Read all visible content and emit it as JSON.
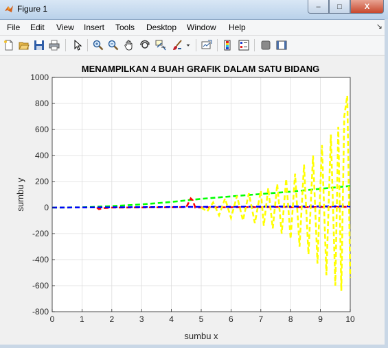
{
  "window": {
    "title": "Figure 1",
    "buttons": {
      "minimize": "–",
      "maximize": "□",
      "close": "X"
    }
  },
  "menu": {
    "items": [
      "File",
      "Edit",
      "View",
      "Insert",
      "Tools",
      "Desktop",
      "Window",
      "Help"
    ],
    "dock_arrow": "↘"
  },
  "toolbar": {
    "icons": [
      "new-figure-icon",
      "open-file-icon",
      "save-icon",
      "print-icon",
      "pointer-icon",
      "zoom-in-icon",
      "zoom-out-icon",
      "pan-icon",
      "rotate-3d-icon",
      "data-cursor-icon",
      "brush-icon",
      "brush-dropdown-icon",
      "link-plot-icon",
      "colorbar-icon",
      "legend-icon",
      "hide-plot-tools-icon",
      "show-plot-tools-icon"
    ]
  },
  "chart_data": {
    "type": "line",
    "title": "MENAMPILKAN 4 BUAH GRAFIK DALAM SATU BIDANG",
    "xlabel": "sumbu x",
    "ylabel": "sumbu y",
    "xlim": [
      0,
      10
    ],
    "ylim": [
      -800,
      1000
    ],
    "xticks": [
      "0",
      "1",
      "2",
      "3",
      "4",
      "5",
      "6",
      "7",
      "8",
      "9",
      "10"
    ],
    "yticks": [
      "-800",
      "-600",
      "-400",
      "-200",
      "0",
      "200",
      "400",
      "600",
      "800",
      "1000"
    ],
    "grid": true,
    "series": [
      {
        "color": "#00ff00",
        "style": "dashed",
        "x": [
          0,
          1,
          2,
          3,
          4,
          5,
          6,
          7,
          8,
          9,
          10
        ],
        "y": [
          0,
          2,
          11,
          24,
          43,
          67,
          86,
          104,
          122,
          144,
          166
        ]
      },
      {
        "color": "#ff0000",
        "style": "dashed",
        "x": [
          1.5,
          1.57,
          1.7,
          2,
          3,
          4,
          4.5,
          4.65,
          4.72,
          4.8,
          5,
          6,
          7,
          7.9,
          8,
          9,
          10
        ],
        "y": [
          0,
          -12,
          -4,
          0,
          1,
          2,
          3,
          70,
          55,
          0,
          1,
          2,
          3,
          5,
          2,
          4,
          5
        ]
      },
      {
        "color": "#0000ff",
        "style": "dashed",
        "x": [
          0,
          1,
          2,
          3,
          4,
          5,
          6,
          7,
          8,
          9,
          10
        ],
        "y": [
          0,
          1,
          2,
          3,
          4,
          5,
          6,
          7,
          8,
          9,
          10
        ]
      },
      {
        "color": "#ffff00",
        "style": "dashed",
        "x": [
          5,
          5.2,
          5.4,
          5.6,
          5.8,
          6,
          6.2,
          6.4,
          6.6,
          6.8,
          7,
          7.1,
          7.25,
          7.4,
          7.55,
          7.7,
          7.85,
          8,
          8.15,
          8.3,
          8.45,
          8.6,
          8.75,
          8.9,
          9.05,
          9.2,
          9.35,
          9.5,
          9.6,
          9.7,
          9.8,
          9.9,
          10
        ],
        "y": [
          0,
          -30,
          40,
          -60,
          70,
          -80,
          90,
          -100,
          110,
          -120,
          130,
          -140,
          150,
          -160,
          180,
          -200,
          220,
          -240,
          260,
          -300,
          330,
          -360,
          400,
          -430,
          480,
          -520,
          560,
          -600,
          620,
          -640,
          700,
          860,
          -540
        ]
      }
    ]
  }
}
